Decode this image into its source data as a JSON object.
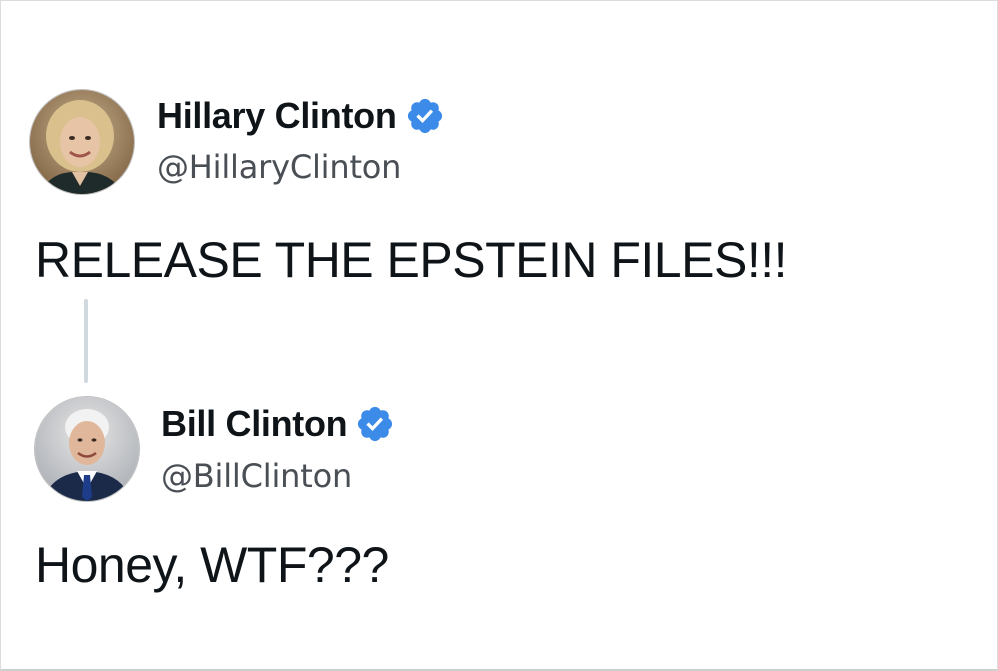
{
  "tweets": [
    {
      "display_name": "Hillary Clinton",
      "handle": "@HillaryClinton",
      "text": "RELEASE THE EPSTEIN FILES!!!",
      "verified": true,
      "avatar_icon": "user-avatar-photo"
    },
    {
      "display_name": "Bill Clinton",
      "handle": "@BillClinton",
      "text": "Honey, WTF???",
      "verified": true,
      "avatar_icon": "user-avatar-photo"
    }
  ],
  "colors": {
    "verified_badge": "#3c8be8",
    "text_primary": "#0f1419",
    "text_secondary": "#4a4f55",
    "thread_line": "#cfd9de"
  },
  "icons": {
    "verified": "verified-badge-icon",
    "thread": "thread-connector-line"
  }
}
